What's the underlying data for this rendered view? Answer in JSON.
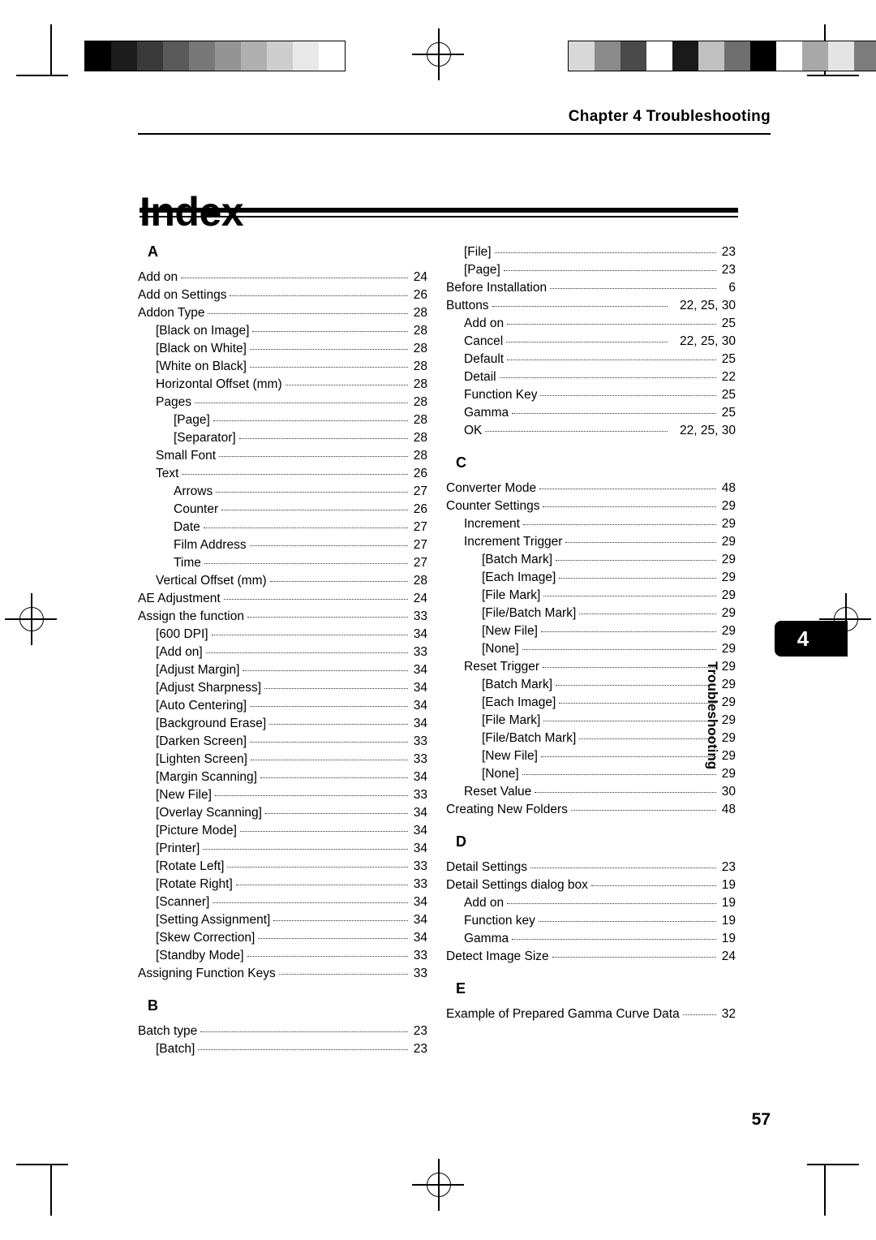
{
  "header": {
    "chapter": "Chapter 4 Troubleshooting"
  },
  "title": "Index",
  "side_tab": {
    "number": "4",
    "label": "Troubleshooting"
  },
  "page_number": "57",
  "columns": {
    "left": [
      {
        "type": "letter",
        "text": "A"
      },
      {
        "level": 0,
        "text": "Add on",
        "page": "24"
      },
      {
        "level": 0,
        "text": "Add on Settings",
        "page": "26"
      },
      {
        "level": 0,
        "text": "Addon Type",
        "page": "28"
      },
      {
        "level": 1,
        "text": "[Black on Image]",
        "page": "28"
      },
      {
        "level": 1,
        "text": "[Black on White]",
        "page": "28"
      },
      {
        "level": 1,
        "text": "[White on Black]",
        "page": "28"
      },
      {
        "level": 1,
        "text": "Horizontal Offset (mm)",
        "page": "28"
      },
      {
        "level": 1,
        "text": "Pages",
        "page": "28"
      },
      {
        "level": 2,
        "text": "[Page]",
        "page": "28"
      },
      {
        "level": 2,
        "text": "[Separator]",
        "page": "28"
      },
      {
        "level": 1,
        "text": "Small Font",
        "page": "28"
      },
      {
        "level": 1,
        "text": "Text",
        "page": "26"
      },
      {
        "level": 2,
        "text": "Arrows",
        "page": "27"
      },
      {
        "level": 2,
        "text": "Counter",
        "page": "26"
      },
      {
        "level": 2,
        "text": "Date",
        "page": "27"
      },
      {
        "level": 2,
        "text": "Film Address",
        "page": "27"
      },
      {
        "level": 2,
        "text": "Time",
        "page": "27"
      },
      {
        "level": 1,
        "text": "Vertical Offset (mm)",
        "page": "28"
      },
      {
        "level": 0,
        "text": "AE Adjustment",
        "page": "24"
      },
      {
        "level": 0,
        "text": "Assign the function",
        "page": "33"
      },
      {
        "level": 1,
        "text": "[600 DPI]",
        "page": "34"
      },
      {
        "level": 1,
        "text": "[Add on]",
        "page": "33"
      },
      {
        "level": 1,
        "text": "[Adjust Margin]",
        "page": "34"
      },
      {
        "level": 1,
        "text": "[Adjust Sharpness]",
        "page": "34"
      },
      {
        "level": 1,
        "text": "[Auto Centering]",
        "page": "34"
      },
      {
        "level": 1,
        "text": "[Background Erase]",
        "page": "34"
      },
      {
        "level": 1,
        "text": "[Darken Screen]",
        "page": "33"
      },
      {
        "level": 1,
        "text": "[Lighten Screen]",
        "page": "33"
      },
      {
        "level": 1,
        "text": "[Margin Scanning]",
        "page": "34"
      },
      {
        "level": 1,
        "text": "[New File]",
        "page": "33"
      },
      {
        "level": 1,
        "text": "[Overlay Scanning]",
        "page": "34"
      },
      {
        "level": 1,
        "text": "[Picture Mode]",
        "page": "34"
      },
      {
        "level": 1,
        "text": "[Printer]",
        "page": "34"
      },
      {
        "level": 1,
        "text": "[Rotate Left]",
        "page": "33"
      },
      {
        "level": 1,
        "text": "[Rotate Right]",
        "page": "33"
      },
      {
        "level": 1,
        "text": "[Scanner]",
        "page": "34"
      },
      {
        "level": 1,
        "text": "[Setting Assignment]",
        "page": "34"
      },
      {
        "level": 1,
        "text": "[Skew Correction]",
        "page": "34"
      },
      {
        "level": 1,
        "text": "[Standby Mode]",
        "page": "33"
      },
      {
        "level": 0,
        "text": "Assigning Function Keys",
        "page": "33"
      },
      {
        "type": "letter",
        "text": "B",
        "spaced": true
      },
      {
        "level": 0,
        "text": "Batch type",
        "page": "23"
      },
      {
        "level": 1,
        "text": "[Batch]",
        "page": "23"
      }
    ],
    "right": [
      {
        "level": 1,
        "text": "[File]",
        "page": "23"
      },
      {
        "level": 1,
        "text": "[Page]",
        "page": "23"
      },
      {
        "level": 0,
        "text": "Before Installation",
        "page": "6"
      },
      {
        "level": 0,
        "text": "Buttons",
        "page": "22,  25,  30",
        "multi": true
      },
      {
        "level": 1,
        "text": "Add on",
        "page": "25"
      },
      {
        "level": 1,
        "text": "Cancel",
        "page": "22,  25,  30",
        "multi": true
      },
      {
        "level": 1,
        "text": "Default",
        "page": "25"
      },
      {
        "level": 1,
        "text": "Detail",
        "page": "22"
      },
      {
        "level": 1,
        "text": "Function Key",
        "page": "25"
      },
      {
        "level": 1,
        "text": "Gamma",
        "page": "25"
      },
      {
        "level": 1,
        "text": "OK",
        "page": "22,  25,  30",
        "multi": true
      },
      {
        "type": "letter",
        "text": "C",
        "spaced": true
      },
      {
        "level": 0,
        "text": "Converter Mode",
        "page": "48"
      },
      {
        "level": 0,
        "text": "Counter Settings",
        "page": "29"
      },
      {
        "level": 1,
        "text": "Increment",
        "page": "29"
      },
      {
        "level": 1,
        "text": "Increment Trigger",
        "page": "29"
      },
      {
        "level": 2,
        "text": "[Batch Mark]",
        "page": "29"
      },
      {
        "level": 2,
        "text": "[Each Image]",
        "page": "29"
      },
      {
        "level": 2,
        "text": "[File Mark]",
        "page": "29"
      },
      {
        "level": 2,
        "text": "[File/Batch Mark]",
        "page": "29"
      },
      {
        "level": 2,
        "text": "[New File]",
        "page": "29"
      },
      {
        "level": 2,
        "text": "[None]",
        "page": "29"
      },
      {
        "level": 1,
        "text": "Reset Trigger",
        "page": "29"
      },
      {
        "level": 2,
        "text": "[Batch Mark]",
        "page": "29"
      },
      {
        "level": 2,
        "text": "[Each Image]",
        "page": "29"
      },
      {
        "level": 2,
        "text": "[File Mark]",
        "page": "29"
      },
      {
        "level": 2,
        "text": "[File/Batch Mark]",
        "page": "29"
      },
      {
        "level": 2,
        "text": "[New File]",
        "page": "29"
      },
      {
        "level": 2,
        "text": "[None]",
        "page": "29"
      },
      {
        "level": 1,
        "text": "Reset Value",
        "page": "30"
      },
      {
        "level": 0,
        "text": "Creating New Folders",
        "page": "48"
      },
      {
        "type": "letter",
        "text": "D",
        "spaced": true
      },
      {
        "level": 0,
        "text": "Detail Settings",
        "page": "23"
      },
      {
        "level": 0,
        "text": "Detail Settings dialog box",
        "page": "19"
      },
      {
        "level": 1,
        "text": "Add on",
        "page": "19"
      },
      {
        "level": 1,
        "text": "Function key",
        "page": "19"
      },
      {
        "level": 1,
        "text": "Gamma",
        "page": "19"
      },
      {
        "level": 0,
        "text": "Detect Image Size",
        "page": "24"
      },
      {
        "type": "letter",
        "text": "E",
        "spaced": true
      },
      {
        "level": 0,
        "text": "Example of Prepared Gamma Curve Data",
        "page": "32"
      }
    ]
  },
  "decor": {
    "greyscale_left": [
      "#000000",
      "#1c1c1c",
      "#3a3a3a",
      "#5a5a5a",
      "#787878",
      "#949494",
      "#b0b0b0",
      "#cdcdcd",
      "#e8e8e8",
      "#ffffff"
    ],
    "greyscale_right": [
      "#d8d8d8",
      "#8a8a8a",
      "#4a4a4a",
      "#ffffff",
      "#1a1a1a",
      "#c0c0c0",
      "#6e6e6e",
      "#000000",
      "#ffffff",
      "#a8a8a8",
      "#e4e4e4",
      "#7c7c7c"
    ]
  }
}
